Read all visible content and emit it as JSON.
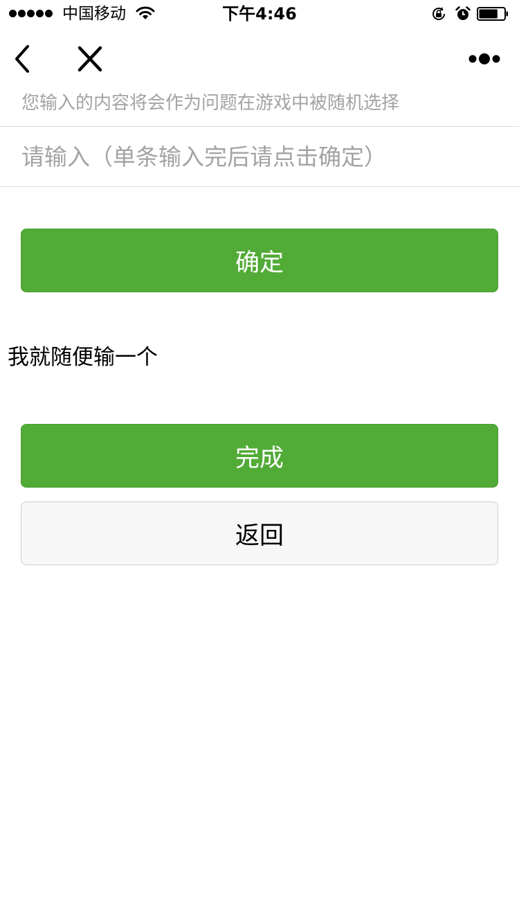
{
  "status_bar": {
    "carrier": "中国移动",
    "time": "下午4:46",
    "battery_level": 0.75,
    "icons": [
      "signal-dots-icon",
      "wifi-icon",
      "rotation-lock-icon",
      "alarm-icon",
      "battery-icon"
    ]
  },
  "nav": {
    "icons": [
      "back-arrow-icon",
      "close-icon",
      "more-icon"
    ]
  },
  "hint_text": "您输入的内容将会作为问题在游戏中被随机选择",
  "input": {
    "value": "",
    "placeholder": "请输入（单条输入完后请点击确定）"
  },
  "buttons": {
    "confirm": "确定",
    "done": "完成",
    "back": "返回"
  },
  "entries": [
    "我就随便输一个"
  ],
  "colors": {
    "primary_green": "#52ab37",
    "hint_gray": "#a3a3a3",
    "secondary_bg": "#f7f7f7",
    "divider": "#dcdcdc"
  }
}
